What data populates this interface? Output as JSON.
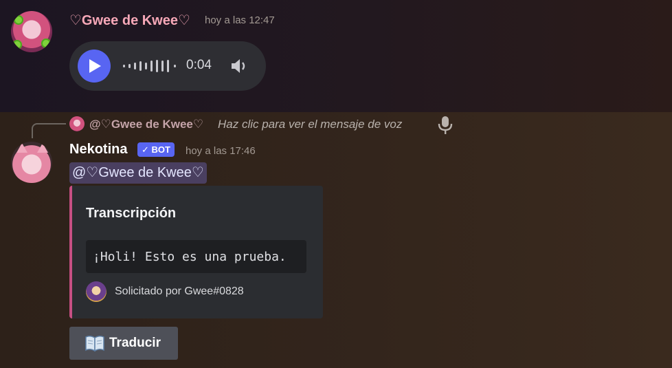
{
  "messages": [
    {
      "author": "♡Gwee de Kwee♡",
      "author_color": "#f7a8b8",
      "timestamp": "hoy a las 12:47",
      "voice_message": {
        "duration": "0:04",
        "play_icon": "play-icon",
        "volume_icon": "speaker-icon"
      }
    },
    {
      "reply": {
        "author": "@♡Gwee de Kwee♡",
        "text": "Haz clic para ver el mensaje de voz",
        "icon": "microphone-icon"
      },
      "author": "Nekotina",
      "author_color": "#ffffff",
      "badge": "✓ BOT",
      "badge_color": "#5865f2",
      "timestamp": "hoy a las 17:46",
      "mention": "@♡Gwee de Kwee♡",
      "embed": {
        "accent_color": "#c74f83",
        "title": "Transcripción",
        "code": "¡Holi! Esto es una prueba.",
        "footer": "Solicitado por Gwee#0828"
      },
      "button": {
        "emoji": "📖",
        "label": "Traducir"
      }
    }
  ]
}
